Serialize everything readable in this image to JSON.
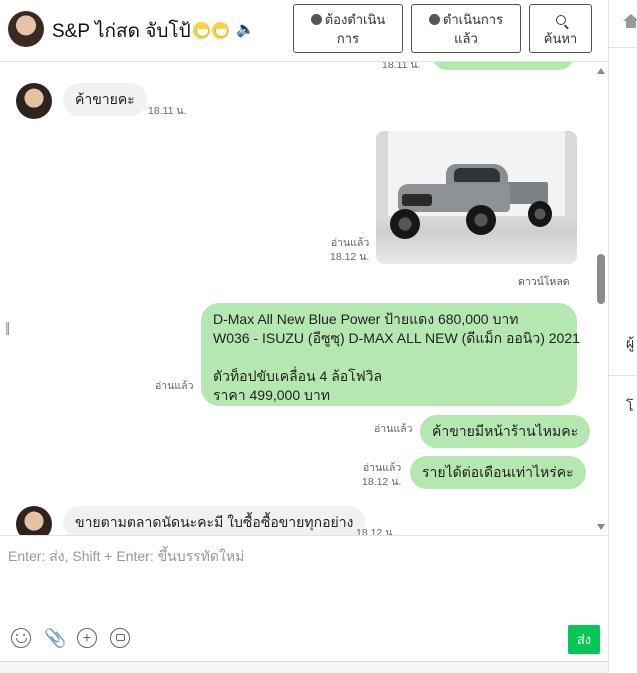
{
  "header": {
    "chat_name": "S&P ไก่สด จับโป้",
    "todo_label_line1": "ต้องดำเนิน",
    "todo_label_line2": "การ",
    "done_label_line1": "ดำเนินการ",
    "done_label_line2": "แล้ว",
    "search_label": "ค้นหา"
  },
  "messages": {
    "top_partial_time": "18.11 น.",
    "m1": {
      "text": "ค้าขายคะ",
      "time": "18.11 น."
    },
    "m2": {
      "read": "อ่านแล้ว",
      "time": "18.12 น.",
      "download": "ดาวน์โหลด"
    },
    "m3": {
      "lines": [
        "D-Max All New Blue Power ป้ายแดง 680,000 บาท",
        "W036 - ISUZU (อีซูซุ) D-MAX ALL NEW (ดีแม็ก ออนิว) 2021",
        "",
        " ตัวท็อปขับเคลื่อน 4 ล้อโฟวิล",
        "ราคา 499,000 บาท"
      ],
      "read": "อ่านแล้ว"
    },
    "m4": {
      "text": "ค้าขายมีหน้าร้านไหมคะ",
      "read": "อ่านแล้ว"
    },
    "m5": {
      "text": "รายได้ต่อเดือนเท่าไหร่คะ",
      "read": "อ่านแล้ว",
      "time": "18.12 น."
    },
    "m6": {
      "text": "ขายตามตลาดนัดนะคะมี ใบซื้อซื้อขายทุกอย่าง",
      "time": "18.12 น."
    }
  },
  "composer": {
    "placeholder": "Enter: ส่ง, Shift + Enter: ขึ้นบรรทัดใหม่",
    "send_label": "ส่ง"
  },
  "right_panel": {
    "text1": "ผู้",
    "text2": "โ"
  },
  "colors": {
    "outgoing_bubble": "#b5e8b0",
    "incoming_bubble": "#f1f1f1",
    "send_button": "#06c755"
  },
  "icons": [
    "speaker-icon",
    "chat-bubble-icon",
    "check-circle-icon",
    "search-icon",
    "home-icon",
    "emoji-icon",
    "paperclip-icon",
    "add-circle-icon",
    "chat-icon"
  ]
}
